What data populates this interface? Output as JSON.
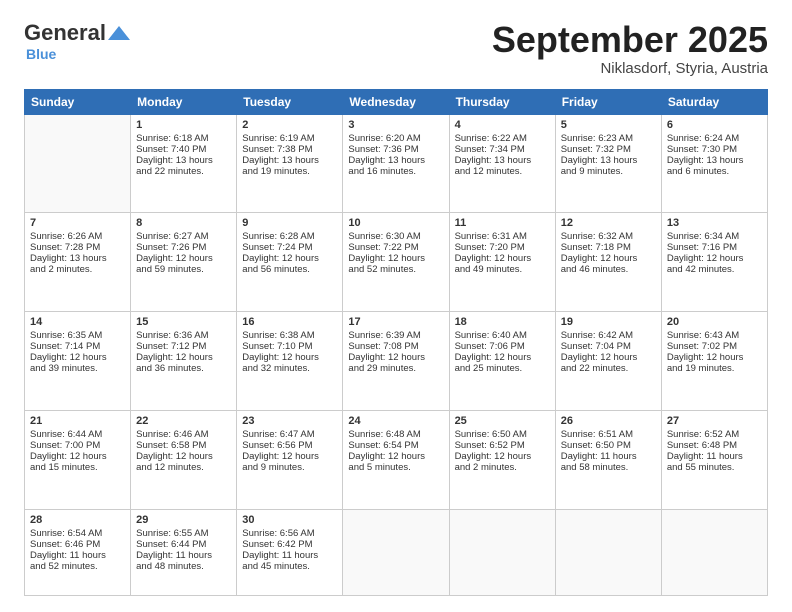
{
  "logo": {
    "general": "General",
    "blue": "Blue"
  },
  "title": "September 2025",
  "subtitle": "Niklasdorf, Styria, Austria",
  "headers": [
    "Sunday",
    "Monday",
    "Tuesday",
    "Wednesday",
    "Thursday",
    "Friday",
    "Saturday"
  ],
  "weeks": [
    [
      {
        "day": "",
        "lines": []
      },
      {
        "day": "1",
        "lines": [
          "Sunrise: 6:18 AM",
          "Sunset: 7:40 PM",
          "Daylight: 13 hours",
          "and 22 minutes."
        ]
      },
      {
        "day": "2",
        "lines": [
          "Sunrise: 6:19 AM",
          "Sunset: 7:38 PM",
          "Daylight: 13 hours",
          "and 19 minutes."
        ]
      },
      {
        "day": "3",
        "lines": [
          "Sunrise: 6:20 AM",
          "Sunset: 7:36 PM",
          "Daylight: 13 hours",
          "and 16 minutes."
        ]
      },
      {
        "day": "4",
        "lines": [
          "Sunrise: 6:22 AM",
          "Sunset: 7:34 PM",
          "Daylight: 13 hours",
          "and 12 minutes."
        ]
      },
      {
        "day": "5",
        "lines": [
          "Sunrise: 6:23 AM",
          "Sunset: 7:32 PM",
          "Daylight: 13 hours",
          "and 9 minutes."
        ]
      },
      {
        "day": "6",
        "lines": [
          "Sunrise: 6:24 AM",
          "Sunset: 7:30 PM",
          "Daylight: 13 hours",
          "and 6 minutes."
        ]
      }
    ],
    [
      {
        "day": "7",
        "lines": [
          "Sunrise: 6:26 AM",
          "Sunset: 7:28 PM",
          "Daylight: 13 hours",
          "and 2 minutes."
        ]
      },
      {
        "day": "8",
        "lines": [
          "Sunrise: 6:27 AM",
          "Sunset: 7:26 PM",
          "Daylight: 12 hours",
          "and 59 minutes."
        ]
      },
      {
        "day": "9",
        "lines": [
          "Sunrise: 6:28 AM",
          "Sunset: 7:24 PM",
          "Daylight: 12 hours",
          "and 56 minutes."
        ]
      },
      {
        "day": "10",
        "lines": [
          "Sunrise: 6:30 AM",
          "Sunset: 7:22 PM",
          "Daylight: 12 hours",
          "and 52 minutes."
        ]
      },
      {
        "day": "11",
        "lines": [
          "Sunrise: 6:31 AM",
          "Sunset: 7:20 PM",
          "Daylight: 12 hours",
          "and 49 minutes."
        ]
      },
      {
        "day": "12",
        "lines": [
          "Sunrise: 6:32 AM",
          "Sunset: 7:18 PM",
          "Daylight: 12 hours",
          "and 46 minutes."
        ]
      },
      {
        "day": "13",
        "lines": [
          "Sunrise: 6:34 AM",
          "Sunset: 7:16 PM",
          "Daylight: 12 hours",
          "and 42 minutes."
        ]
      }
    ],
    [
      {
        "day": "14",
        "lines": [
          "Sunrise: 6:35 AM",
          "Sunset: 7:14 PM",
          "Daylight: 12 hours",
          "and 39 minutes."
        ]
      },
      {
        "day": "15",
        "lines": [
          "Sunrise: 6:36 AM",
          "Sunset: 7:12 PM",
          "Daylight: 12 hours",
          "and 36 minutes."
        ]
      },
      {
        "day": "16",
        "lines": [
          "Sunrise: 6:38 AM",
          "Sunset: 7:10 PM",
          "Daylight: 12 hours",
          "and 32 minutes."
        ]
      },
      {
        "day": "17",
        "lines": [
          "Sunrise: 6:39 AM",
          "Sunset: 7:08 PM",
          "Daylight: 12 hours",
          "and 29 minutes."
        ]
      },
      {
        "day": "18",
        "lines": [
          "Sunrise: 6:40 AM",
          "Sunset: 7:06 PM",
          "Daylight: 12 hours",
          "and 25 minutes."
        ]
      },
      {
        "day": "19",
        "lines": [
          "Sunrise: 6:42 AM",
          "Sunset: 7:04 PM",
          "Daylight: 12 hours",
          "and 22 minutes."
        ]
      },
      {
        "day": "20",
        "lines": [
          "Sunrise: 6:43 AM",
          "Sunset: 7:02 PM",
          "Daylight: 12 hours",
          "and 19 minutes."
        ]
      }
    ],
    [
      {
        "day": "21",
        "lines": [
          "Sunrise: 6:44 AM",
          "Sunset: 7:00 PM",
          "Daylight: 12 hours",
          "and 15 minutes."
        ]
      },
      {
        "day": "22",
        "lines": [
          "Sunrise: 6:46 AM",
          "Sunset: 6:58 PM",
          "Daylight: 12 hours",
          "and 12 minutes."
        ]
      },
      {
        "day": "23",
        "lines": [
          "Sunrise: 6:47 AM",
          "Sunset: 6:56 PM",
          "Daylight: 12 hours",
          "and 9 minutes."
        ]
      },
      {
        "day": "24",
        "lines": [
          "Sunrise: 6:48 AM",
          "Sunset: 6:54 PM",
          "Daylight: 12 hours",
          "and 5 minutes."
        ]
      },
      {
        "day": "25",
        "lines": [
          "Sunrise: 6:50 AM",
          "Sunset: 6:52 PM",
          "Daylight: 12 hours",
          "and 2 minutes."
        ]
      },
      {
        "day": "26",
        "lines": [
          "Sunrise: 6:51 AM",
          "Sunset: 6:50 PM",
          "Daylight: 11 hours",
          "and 58 minutes."
        ]
      },
      {
        "day": "27",
        "lines": [
          "Sunrise: 6:52 AM",
          "Sunset: 6:48 PM",
          "Daylight: 11 hours",
          "and 55 minutes."
        ]
      }
    ],
    [
      {
        "day": "28",
        "lines": [
          "Sunrise: 6:54 AM",
          "Sunset: 6:46 PM",
          "Daylight: 11 hours",
          "and 52 minutes."
        ]
      },
      {
        "day": "29",
        "lines": [
          "Sunrise: 6:55 AM",
          "Sunset: 6:44 PM",
          "Daylight: 11 hours",
          "and 48 minutes."
        ]
      },
      {
        "day": "30",
        "lines": [
          "Sunrise: 6:56 AM",
          "Sunset: 6:42 PM",
          "Daylight: 11 hours",
          "and 45 minutes."
        ]
      },
      {
        "day": "",
        "lines": []
      },
      {
        "day": "",
        "lines": []
      },
      {
        "day": "",
        "lines": []
      },
      {
        "day": "",
        "lines": []
      }
    ]
  ]
}
